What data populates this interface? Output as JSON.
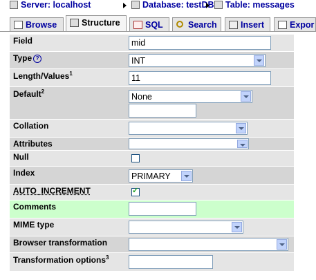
{
  "breadcrumb": {
    "server": "Server: localhost",
    "database": "Database: testDB",
    "table": "Table: messages"
  },
  "tabs": [
    {
      "label": "Browse",
      "icon": "browse-icon"
    },
    {
      "label": "Structure",
      "icon": "structure-icon",
      "active": true
    },
    {
      "label": "SQL",
      "icon": "sql-icon"
    },
    {
      "label": "Search",
      "icon": "search-icon"
    },
    {
      "label": "Insert",
      "icon": "insert-icon"
    },
    {
      "label": "Expor",
      "icon": "export-icon"
    }
  ],
  "form": {
    "field": {
      "label": "Field",
      "value": "mid"
    },
    "type": {
      "label": "Type",
      "value": "INT"
    },
    "length": {
      "label": "Length/Values",
      "sup": "1",
      "value": "11"
    },
    "default": {
      "label": "Default",
      "sup": "2",
      "value": "None",
      "extra": ""
    },
    "collation": {
      "label": "Collation",
      "value": ""
    },
    "attributes": {
      "label": "Attributes",
      "value": ""
    },
    "null": {
      "label": "Null",
      "checked": false
    },
    "index": {
      "label": "Index",
      "value": "PRIMARY"
    },
    "auto_increment": {
      "label": "AUTO_INCREMENT",
      "checked": true
    },
    "comments": {
      "label": "Comments",
      "value": ""
    },
    "mime": {
      "label": "MIME type",
      "value": ""
    },
    "browser_transformation": {
      "label": "Browser transformation",
      "value": ""
    },
    "transformation_options": {
      "label": "Transformation options",
      "sup": "3",
      "value": ""
    }
  },
  "colors": {
    "accent": "#0000a0",
    "highlight_row": "#ccffcc"
  }
}
